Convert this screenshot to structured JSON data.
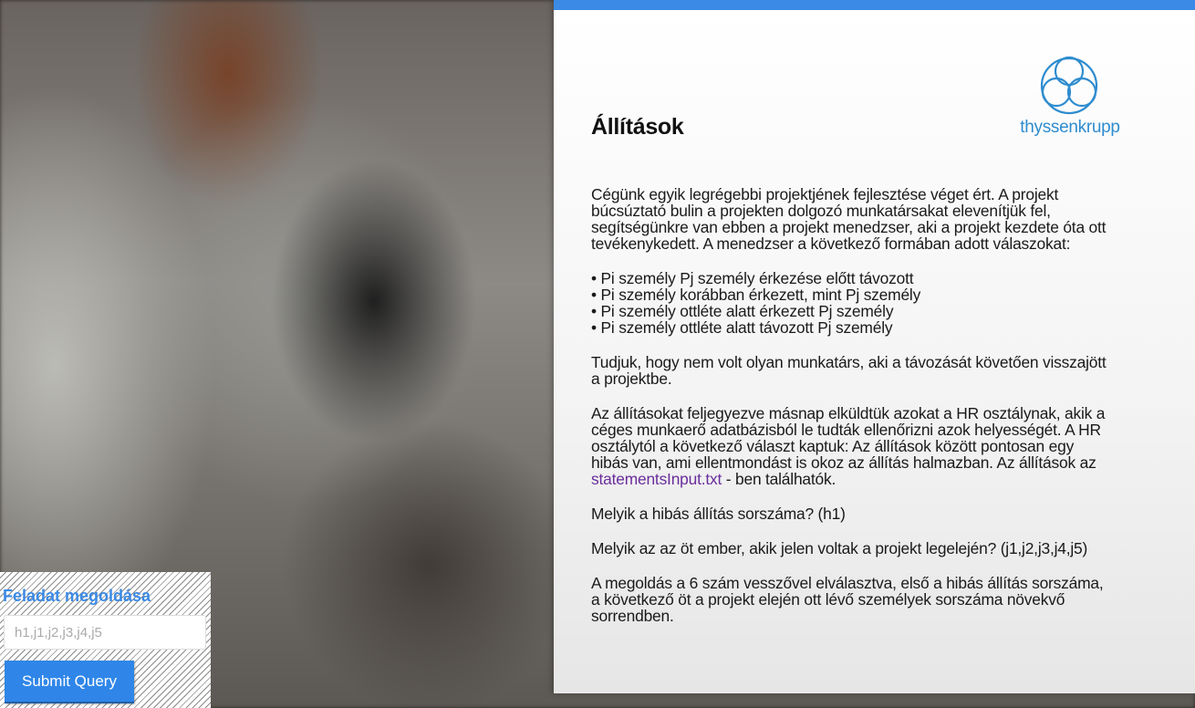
{
  "card": {
    "title": "Állítások",
    "logo_text": "thyssenkrupp",
    "intro": "Cégünk egyik legrégebbi projektjének fejlesztése véget ért. A projekt búcsúztató bulin a projekten dolgozó munkatársakat elevenítjük fel, segítségünkre van ebben a projekt menedzser, aki a projekt kezdete óta ott tevékenykedett. A menedzser a következő formában adott válaszokat:",
    "bullets": [
      "Pi személy Pj személy érkezése előtt távozott",
      "Pi személy korábban érkezett, mint Pj személy",
      "Pi személy ottléte alatt érkezett Pj személy",
      "Pi személy ottléte alatt távozott Pj személy"
    ],
    "paragraph2": "Tudjuk, hogy nem volt olyan munkatárs, aki a távozását követően visszajött a projektbe.",
    "paragraph3": "Az állításokat feljegyezve másnap elküldtük azokat a HR osztálynak, akik a céges munkaerő adatbázisból le tudták ellenőrizni azok helyességét. A HR osztálytól a következő választ kaptuk: Az állítások között pontosan egy hibás van, ami ellentmondást is okoz az állítás halmazban. Az állítások az",
    "link_text": "statementsInput.txt",
    "link_suffix": " - ben találhatók.",
    "question1": "Melyik a hibás állítás sorszáma? (h1)",
    "question2": "Melyik az az öt ember, akik jelen voltak a projekt legelején? (j1,j2,j3,j4,j5)",
    "answer_format": "A megoldás a 6 szám vesszővel elválasztva, első a hibás állítás sorszáma, a következő öt a projekt elején ott lévő személyek sorszáma növekvő sorrendben."
  },
  "form": {
    "title": "Feladat megoldása",
    "input_placeholder": "h1,j1,j2,j3,j4,j5",
    "input_value": "",
    "submit_label": "Submit Query"
  },
  "colors": {
    "accent": "#3b8ae6",
    "logo": "#2f8ccf",
    "link": "#6a2d9c",
    "button": "#2f86e8"
  },
  "icons": {
    "logo": "thyssenkrupp-rings-logo-icon"
  }
}
